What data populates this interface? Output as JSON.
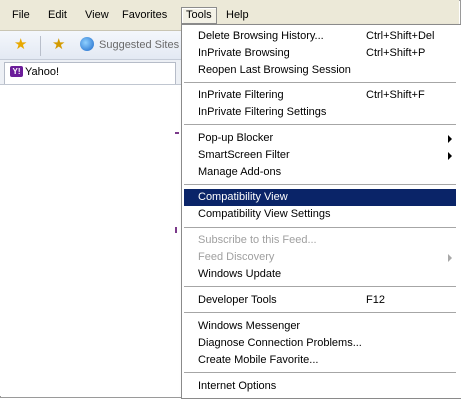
{
  "menubar": {
    "items": [
      {
        "label": "File"
      },
      {
        "label": "Edit"
      },
      {
        "label": "View"
      },
      {
        "label": "Favorites"
      },
      {
        "label": "Tools"
      },
      {
        "label": "Help"
      }
    ]
  },
  "favorites_bar": {
    "suggested_sites_label": "Suggested Sites"
  },
  "tab": {
    "label": "Yahoo!",
    "icon_text": "Y!"
  },
  "tools_menu": {
    "items": [
      {
        "label": "Delete Browsing History...",
        "shortcut": "Ctrl+Shift+Del"
      },
      {
        "label": "InPrivate Browsing",
        "shortcut": "Ctrl+Shift+P"
      },
      {
        "label": "Reopen Last Browsing Session",
        "shortcut": ""
      },
      {
        "label": "InPrivate Filtering",
        "shortcut": "Ctrl+Shift+F"
      },
      {
        "label": "InPrivate Filtering Settings",
        "shortcut": ""
      },
      {
        "label": "Pop-up Blocker",
        "shortcut": ""
      },
      {
        "label": "SmartScreen Filter",
        "shortcut": ""
      },
      {
        "label": "Manage Add-ons",
        "shortcut": ""
      },
      {
        "label": "Compatibility View",
        "shortcut": ""
      },
      {
        "label": "Compatibility View Settings",
        "shortcut": ""
      },
      {
        "label": "Subscribe to this Feed...",
        "shortcut": ""
      },
      {
        "label": "Feed Discovery",
        "shortcut": ""
      },
      {
        "label": "Windows Update",
        "shortcut": ""
      },
      {
        "label": "Developer Tools",
        "shortcut": "F12"
      },
      {
        "label": "Windows Messenger",
        "shortcut": ""
      },
      {
        "label": "Diagnose Connection Problems...",
        "shortcut": ""
      },
      {
        "label": "Create Mobile Favorite...",
        "shortcut": ""
      },
      {
        "label": "Internet Options",
        "shortcut": ""
      }
    ]
  }
}
